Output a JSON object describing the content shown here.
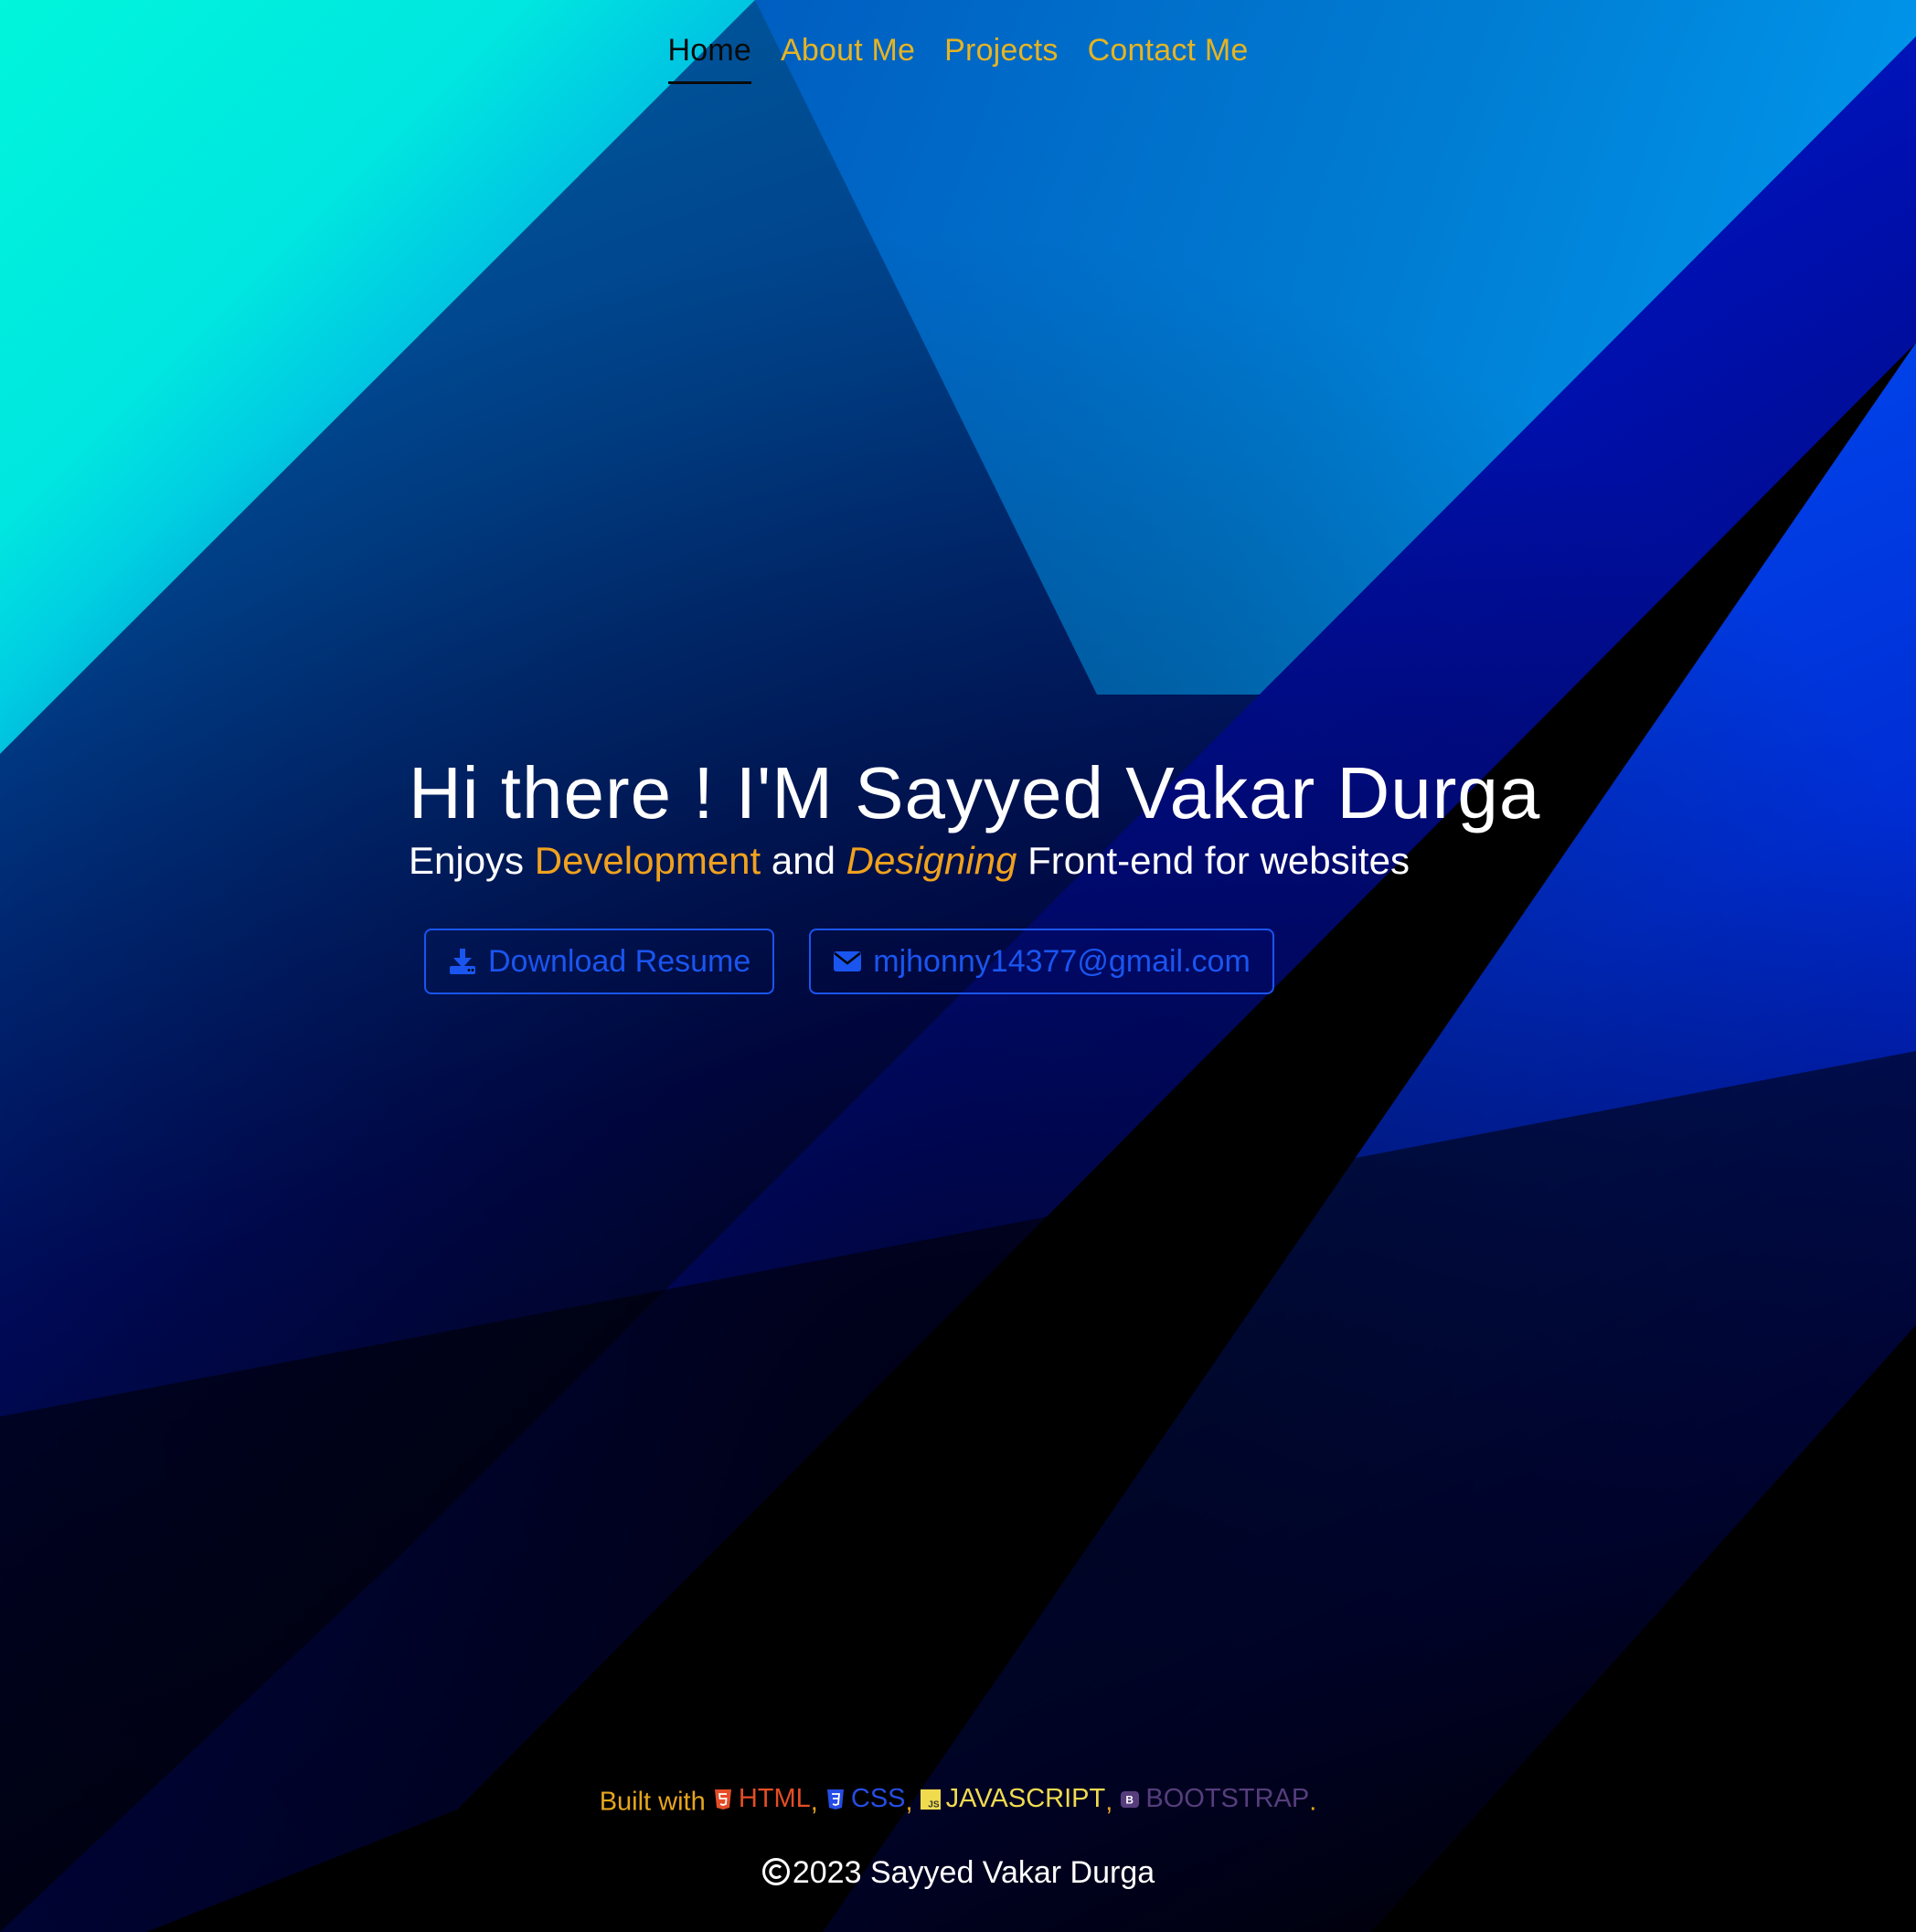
{
  "nav": {
    "items": [
      {
        "label": "Home",
        "active": true
      },
      {
        "label": "About Me",
        "active": false
      },
      {
        "label": "Projects",
        "active": false
      },
      {
        "label": "Contact Me",
        "active": false
      }
    ]
  },
  "hero": {
    "heading": "Hi there ! I'M Sayyed Vakar Durga",
    "tagline": {
      "prefix": "Enjoys ",
      "highlight1": "Development",
      "middle": " and ",
      "highlight2": "Designing",
      "suffix": " Front-end for websites"
    },
    "buttons": {
      "resume_label": "Download Resume",
      "email_label": "mjhonny14377@gmail.com"
    }
  },
  "footer": {
    "built_prefix": "Built with",
    "tech": [
      {
        "label": "HTML",
        "icon": "html5-icon"
      },
      {
        "label": "CSS",
        "icon": "css3-icon"
      },
      {
        "label": "JAVASCRIPT",
        "icon": "js-icon"
      },
      {
        "label": "BOOTSTRAP",
        "icon": "bootstrap-icon"
      }
    ],
    "separator": ",",
    "end_mark": ".",
    "copyright": "2023 Sayyed Vakar Durga"
  },
  "colors": {
    "accent_gold": "#f0a21e",
    "button_blue": "#1a55f0",
    "html": "#e44d26",
    "css": "#264de4",
    "js": "#f0db4f",
    "bootstrap": "#563d7c"
  }
}
